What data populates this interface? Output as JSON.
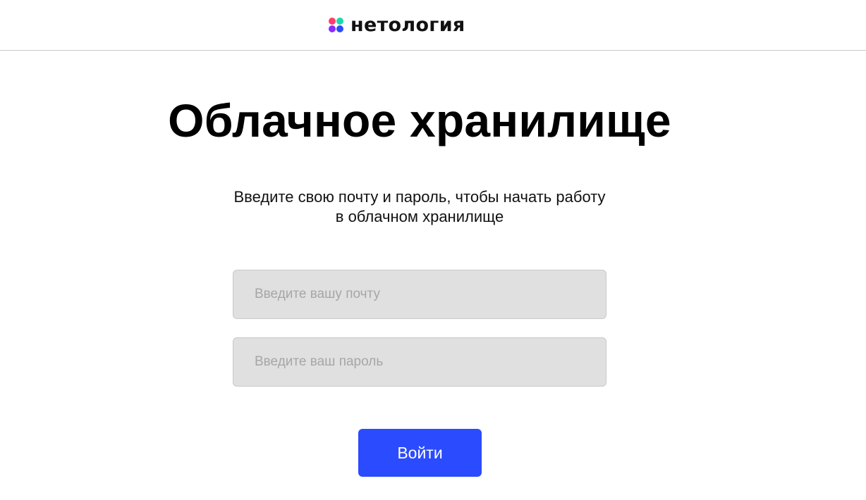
{
  "header": {
    "logo_text": "нетология",
    "logo_colors": [
      "#ff3e6c",
      "#19d9b0",
      "#8a2bff",
      "#2b4bff"
    ]
  },
  "main": {
    "title": "Облачное хранилище",
    "subtitle": "Введите свою почту и пароль, чтобы начать работу в облачном хранилище",
    "email_placeholder": "Введите вашу почту",
    "email_value": "",
    "password_placeholder": "Введите ваш пароль",
    "password_value": "",
    "login_label": "Войти"
  },
  "colors": {
    "accent": "#2b4bff",
    "input_bg": "#e0e0e0",
    "placeholder": "#a6a6a6"
  }
}
